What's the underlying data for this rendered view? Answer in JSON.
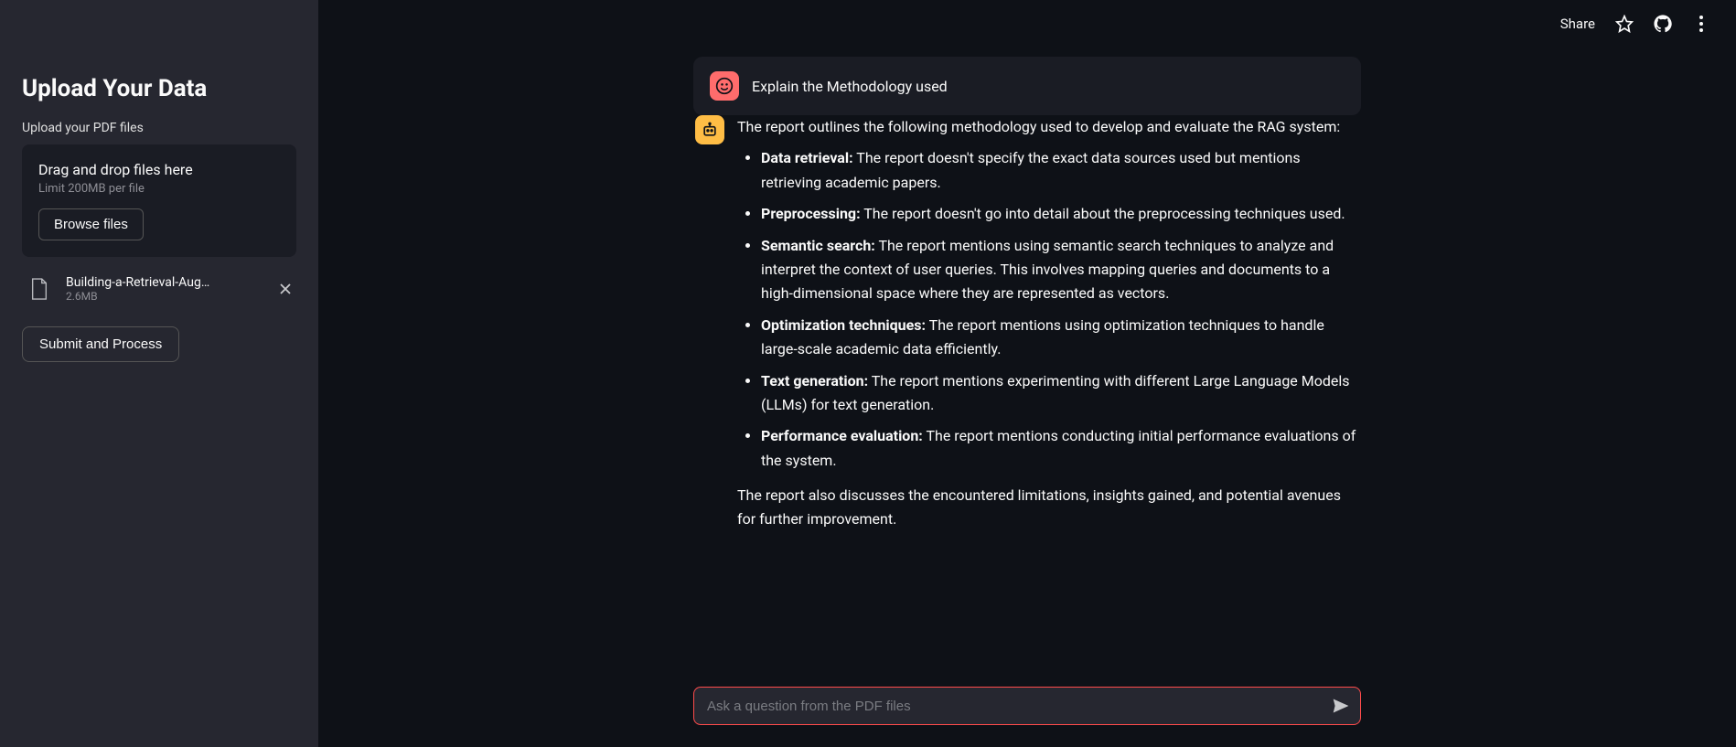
{
  "topbar": {
    "share_label": "Share"
  },
  "sidebar": {
    "title": "Upload Your Data",
    "subtitle": "Upload your PDF files",
    "dropzone_title": "Drag and drop files here",
    "dropzone_limit": "Limit 200MB per file",
    "browse_label": "Browse files",
    "file_name": "Building-a-Retrieval-Aug…",
    "file_size": "2.6MB",
    "submit_label": "Submit and Process"
  },
  "chat": {
    "user_message": "Explain the Methodology used",
    "bot_intro": "The report outlines the following methodology used to develop and evaluate the RAG system:",
    "items": [
      {
        "label": "Data retrieval:",
        "text": " The report doesn't specify the exact data sources used but mentions retrieving academic papers."
      },
      {
        "label": "Preprocessing:",
        "text": " The report doesn't go into detail about the preprocessing techniques used."
      },
      {
        "label": "Semantic search:",
        "text": " The report mentions using semantic search techniques to analyze and interpret the context of user queries. This involves mapping queries and documents to a high-dimensional space where they are represented as vectors."
      },
      {
        "label": "Optimization techniques:",
        "text": " The report mentions using optimization techniques to handle large-scale academic data efficiently."
      },
      {
        "label": "Text generation:",
        "text": " The report mentions experimenting with different Large Language Models (LLMs) for text generation."
      },
      {
        "label": "Performance evaluation:",
        "text": " The report mentions conducting initial performance evaluations of the system."
      }
    ],
    "bot_outro": "The report also discusses the encountered limitations, insights gained, and potential avenues for further improvement.",
    "input_placeholder": "Ask a question from the PDF files"
  }
}
